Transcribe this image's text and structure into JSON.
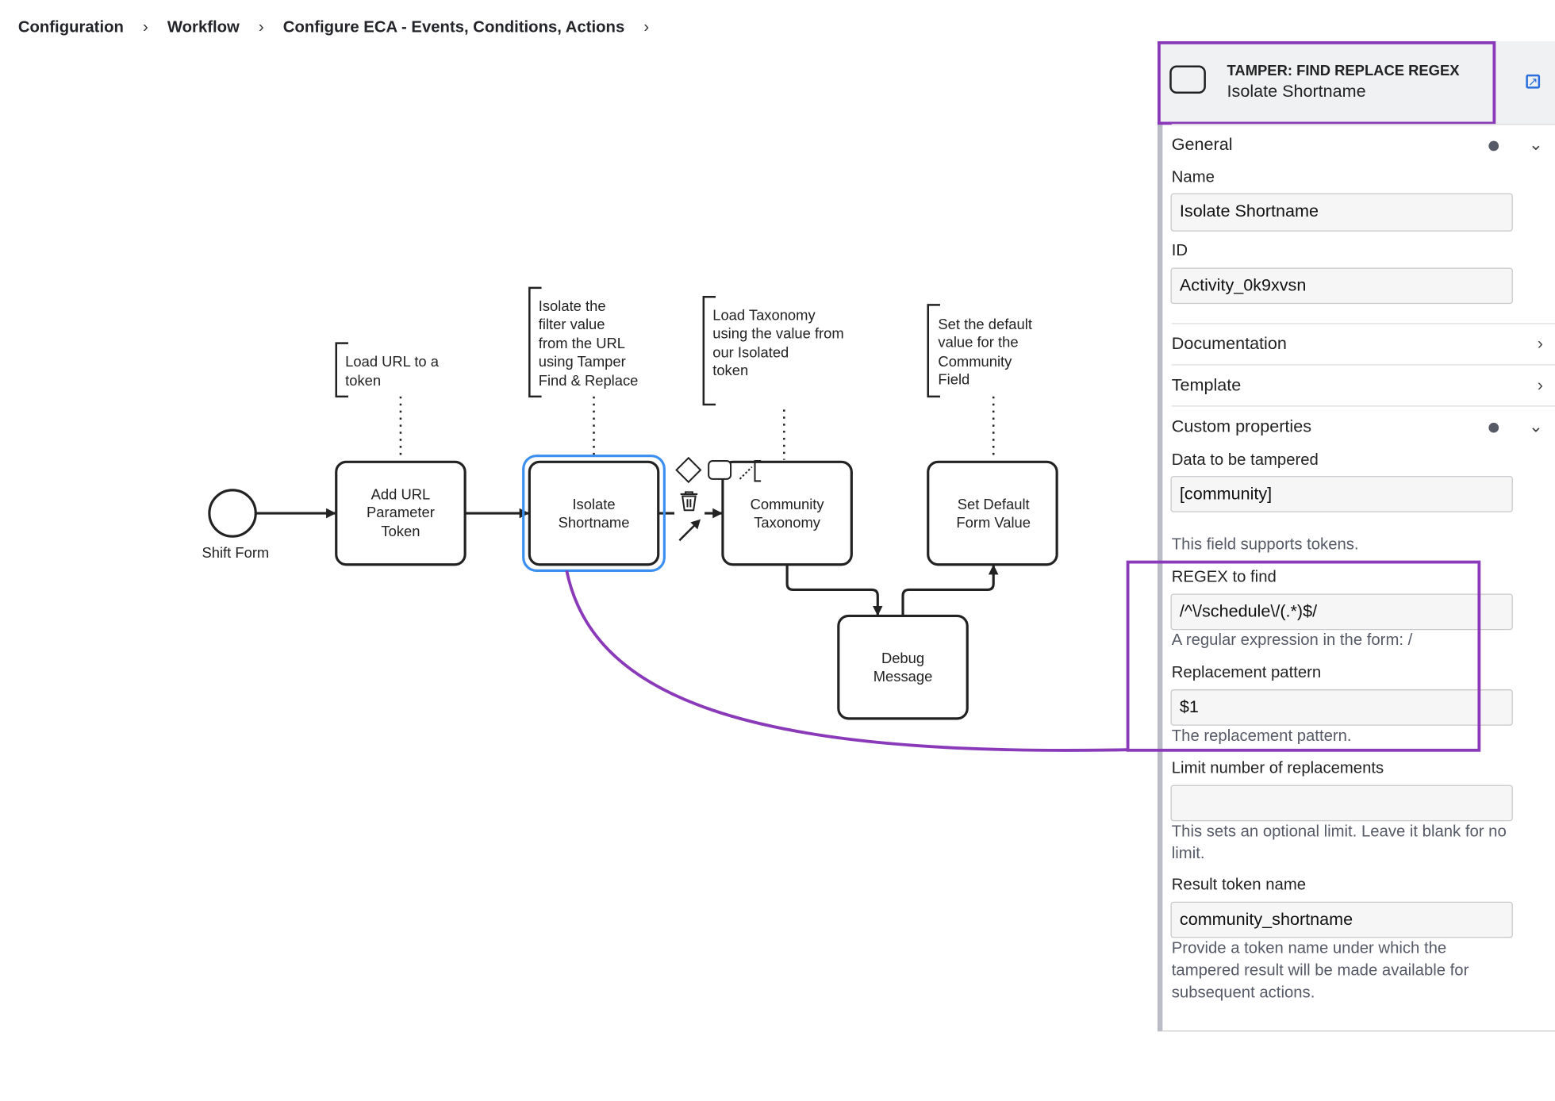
{
  "breadcrumb": [
    "Configuration",
    "Workflow",
    "Configure ECA - Events, Conditions, Actions"
  ],
  "colors": {
    "highlight": "#8a3ab9",
    "selection": "#3b8ff0",
    "link": "#2a6fdb"
  },
  "diagram": {
    "start_event": {
      "label": "Shift Form"
    },
    "tasks": {
      "add_url": [
        "Add URL",
        "Parameter",
        "Token"
      ],
      "isolate": [
        "Isolate",
        "Shortname"
      ],
      "community": [
        "Community",
        "Taxonomy"
      ],
      "set_default": [
        "Set Default",
        "Form Value"
      ],
      "debug": [
        "Debug",
        "Message"
      ]
    },
    "annotations": {
      "add_url": [
        "Load URL to a",
        "token"
      ],
      "isolate": [
        "Isolate the",
        "filter value",
        "from the URL",
        "using Tamper",
        "Find & Replace"
      ],
      "community": [
        "Load Taxonomy",
        "using the value from",
        "our Isolated",
        "token"
      ],
      "set_default": [
        "Set the default",
        "value for the",
        "Community",
        "Field"
      ]
    },
    "context_pad_icons": [
      "gateway-icon",
      "task-icon",
      "annotation-icon",
      "delete-icon",
      "connect-icon"
    ]
  },
  "panel": {
    "type": "TAMPER: FIND REPLACE REGEX",
    "name": "Isolate Shortname",
    "sections": {
      "general": "General",
      "documentation": "Documentation",
      "template": "Template",
      "custom": "Custom properties"
    },
    "fields": {
      "name": {
        "label": "Name",
        "value": "Isolate Shortname"
      },
      "id": {
        "label": "ID",
        "value": "Activity_0k9xvsn"
      },
      "data": {
        "label": "Data to be tampered",
        "value": "[community]",
        "help": "This field supports tokens."
      },
      "regex": {
        "label": "REGEX to find",
        "value": "/^\\/schedule\\/(.*)$/",
        "help": "A regular expression in the form: /"
      },
      "replacement": {
        "label": "Replacement pattern",
        "value": "$1",
        "help": "The replacement pattern."
      },
      "limit": {
        "label": "Limit number of replacements",
        "value": "",
        "help": "This sets an optional limit. Leave it blank for no limit."
      },
      "result": {
        "label": "Result token name",
        "value": "community_shortname",
        "help": "Provide a token name under which the tampered result will be made available for subsequent actions."
      }
    }
  }
}
